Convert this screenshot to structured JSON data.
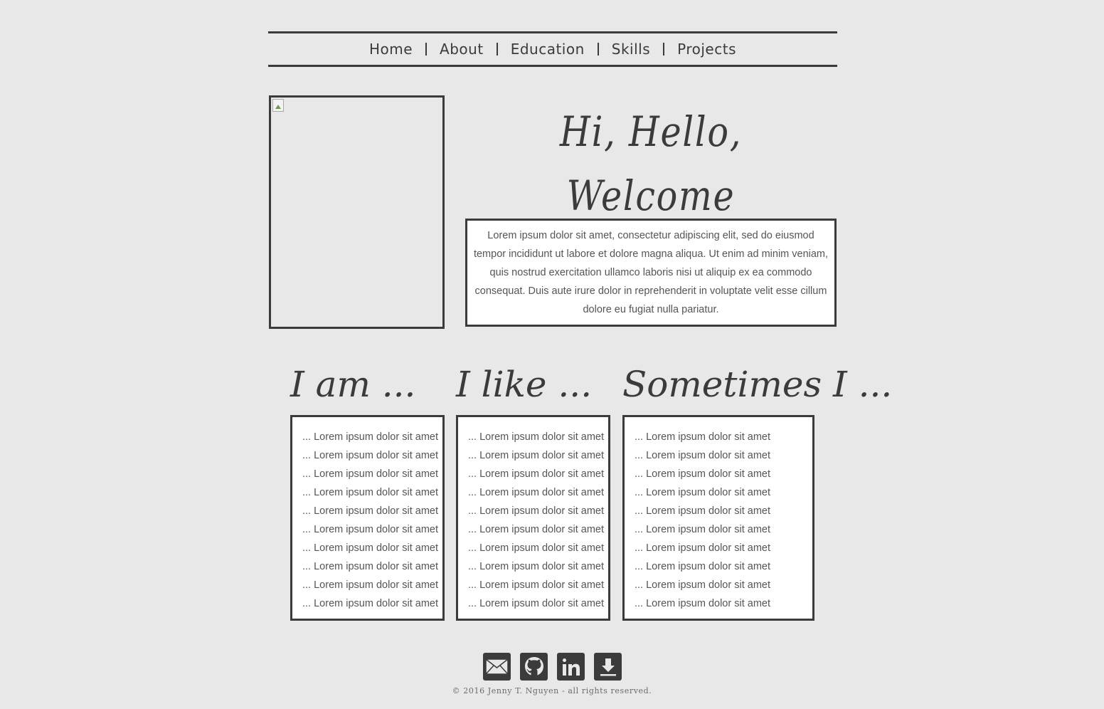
{
  "nav": {
    "items": [
      "Home",
      "About",
      "Education",
      "Skills",
      "Projects"
    ]
  },
  "hero": {
    "title": "Hi, Hello, Welcome",
    "intro": "Lorem ipsum dolor sit amet, consectetur adipiscing elit, sed do eiusmod tempor incididunt ut labore et dolore magna aliqua. Ut enim ad minim veniam, quis nostrud exercitation ullamco laboris nisi ut aliquip ex ea commodo consequat. Duis aute irure dolor in reprehenderit in voluptate velit esse cillum dolore eu fugiat nulla pariatur."
  },
  "columns": [
    {
      "title": "I am ...",
      "items": [
        "... Lorem ipsum dolor sit amet",
        "... Lorem ipsum dolor sit amet",
        "... Lorem ipsum dolor sit amet",
        "... Lorem ipsum dolor sit amet",
        "... Lorem ipsum dolor sit amet",
        "... Lorem ipsum dolor sit amet",
        "... Lorem ipsum dolor sit amet",
        "... Lorem ipsum dolor sit amet",
        "... Lorem ipsum dolor sit amet",
        "... Lorem ipsum dolor sit amet"
      ]
    },
    {
      "title": "I like ...",
      "items": [
        "... Lorem ipsum dolor sit amet",
        "... Lorem ipsum dolor sit amet",
        "... Lorem ipsum dolor sit amet",
        "... Lorem ipsum dolor sit amet",
        "... Lorem ipsum dolor sit amet",
        "... Lorem ipsum dolor sit amet",
        "... Lorem ipsum dolor sit amet",
        "... Lorem ipsum dolor sit amet",
        "... Lorem ipsum dolor sit amet",
        "... Lorem ipsum dolor sit amet"
      ]
    },
    {
      "title": "Sometimes I ...",
      "items": [
        "... Lorem ipsum dolor sit amet",
        "... Lorem ipsum dolor sit amet",
        "... Lorem ipsum dolor sit amet",
        "... Lorem ipsum dolor sit amet",
        "... Lorem ipsum dolor sit amet",
        "... Lorem ipsum dolor sit amet",
        "... Lorem ipsum dolor sit amet",
        "... Lorem ipsum dolor sit amet",
        "... Lorem ipsum dolor sit amet",
        "... Lorem ipsum dolor sit amet"
      ]
    }
  ],
  "social": {
    "icons": [
      "mail-icon",
      "github-icon",
      "linkedin-icon",
      "download-icon"
    ]
  },
  "footer": {
    "copyright": "© 2016 Jenny T. Nguyen - all rights reserved."
  },
  "colors": {
    "background": "#e8e8e8",
    "ink": "#3b3b3b",
    "panel": "#ffffff"
  }
}
